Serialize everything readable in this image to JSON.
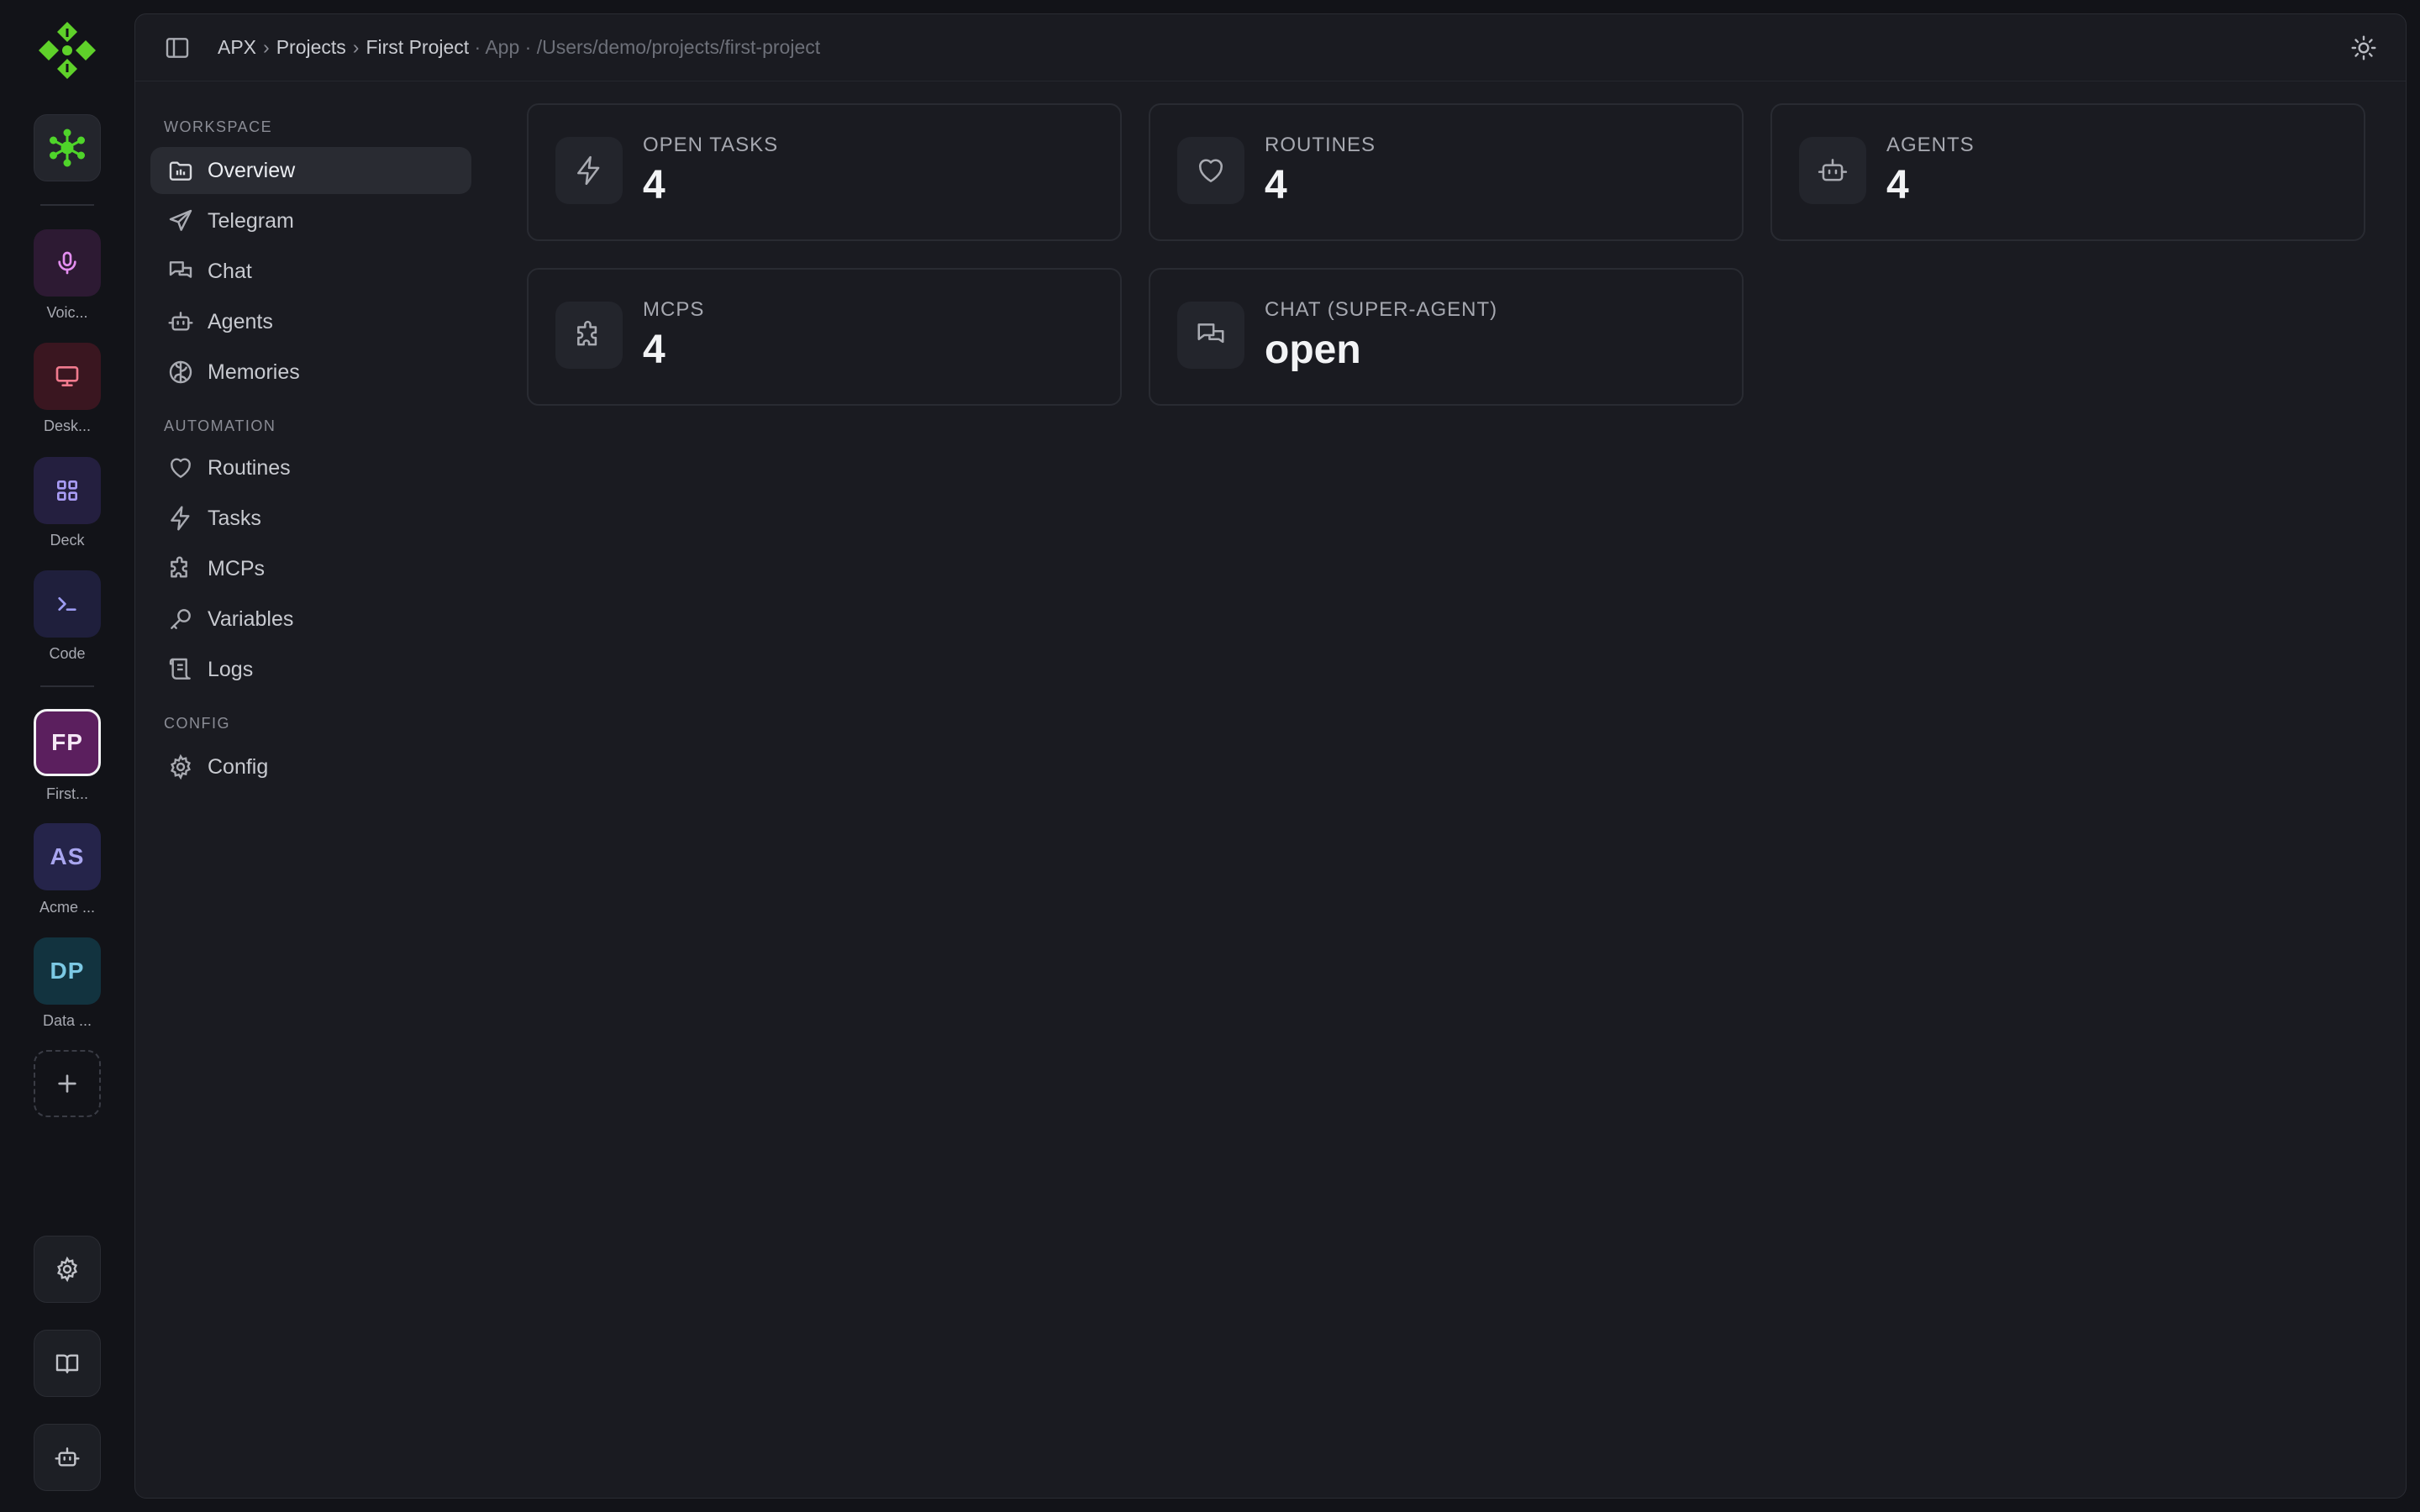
{
  "rail": {
    "apps": [
      {
        "label": "Voic...",
        "icon": "microphone-icon"
      },
      {
        "label": "Desk...",
        "icon": "monitor-icon"
      },
      {
        "label": "Deck",
        "icon": "grid-icon"
      },
      {
        "label": "Code",
        "icon": "terminal-icon"
      }
    ],
    "projects": [
      {
        "initials": "FP",
        "label": "First...",
        "color": "#5b1f5e",
        "text_color": "#f4e7f5"
      },
      {
        "initials": "AS",
        "label": "Acme ...",
        "color": "#25244a",
        "text_color": "#a9a6f0"
      },
      {
        "initials": "DP",
        "label": "Data ...",
        "color": "#12333f",
        "text_color": "#7cc9e4"
      }
    ]
  },
  "breadcrumb": {
    "root": "APX",
    "projects": "Projects",
    "project": "First Project",
    "context": "· App · /Users/demo/projects/first-project"
  },
  "nav": {
    "sections": {
      "workspace": "WORKSPACE",
      "automation": "AUTOMATION",
      "config": "CONFIG"
    },
    "items": {
      "overview": "Overview",
      "telegram": "Telegram",
      "chat": "Chat",
      "agents": "Agents",
      "memories": "Memories",
      "routines": "Routines",
      "tasks": "Tasks",
      "mcps": "MCPs",
      "variables": "Variables",
      "logs": "Logs",
      "config": "Config"
    }
  },
  "cards": {
    "open_tasks": {
      "label": "OPEN TASKS",
      "value": "4"
    },
    "routines": {
      "label": "ROUTINES",
      "value": "4"
    },
    "agents": {
      "label": "AGENTS",
      "value": "4"
    },
    "mcps": {
      "label": "MCPS",
      "value": "4"
    },
    "chat": {
      "label": "CHAT (SUPER-AGENT)",
      "value": "open"
    }
  },
  "colors": {
    "accent_green": "#6ee02a",
    "background": "#121318",
    "panel": "#1a1b21"
  }
}
